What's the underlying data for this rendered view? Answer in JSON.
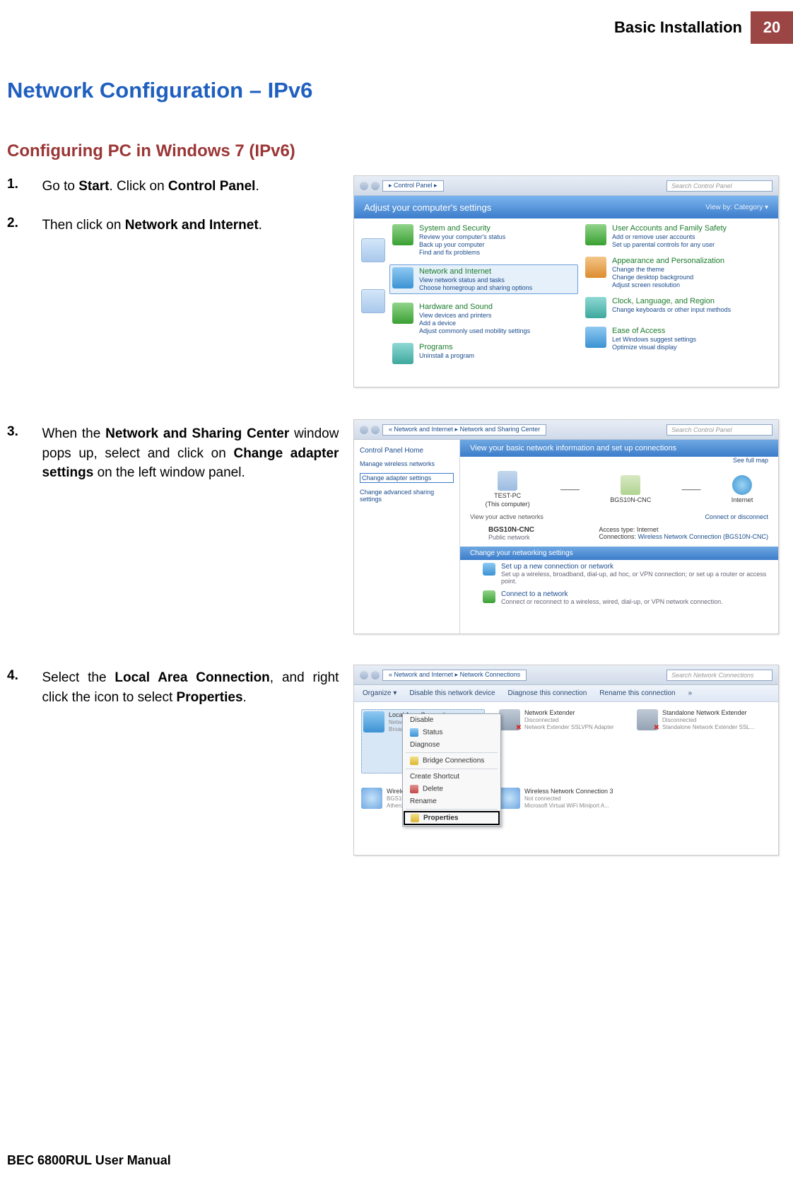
{
  "header": {
    "section": "Basic Installation",
    "page_number": "20"
  },
  "titles": {
    "main": "Network Configuration – IPv6",
    "sub": "Configuring PC in Windows 7 (IPv6)"
  },
  "steps": {
    "s1": {
      "num": "1.",
      "t1": "Go to ",
      "b1": "Start",
      "t2": ". Click on ",
      "b2": "Control Panel",
      "t3": "."
    },
    "s2": {
      "num": "2.",
      "t1": "Then click on ",
      "b1": "Network and Internet",
      "t2": "."
    },
    "s3": {
      "num": "3.",
      "t1": "When the ",
      "b1": "Network and Sharing Center",
      "t2": " window pops up, select and click on ",
      "b2": "Change adapter settings",
      "t3": " on the left window panel."
    },
    "s4": {
      "num": "4.",
      "t1": "Select the ",
      "b1": "Local Area Connection",
      "t2": ", and right click the icon to select ",
      "b2": "Properties",
      "t3": "."
    }
  },
  "shot1": {
    "crumb": "▸ Control Panel ▸",
    "search": "Search Control Panel",
    "banner": "Adjust your computer's settings",
    "viewby": "View by:   Category ▾",
    "left": [
      {
        "title": "System and Security",
        "links": [
          "Review your computer's status",
          "Back up your computer",
          "Find and fix problems"
        ],
        "ic": "ci-green"
      },
      {
        "title": "Network and Internet",
        "links": [
          "View network status and tasks",
          "Choose homegroup and sharing options"
        ],
        "ic": "ci-blue",
        "hl": true
      },
      {
        "title": "Hardware and Sound",
        "links": [
          "View devices and printers",
          "Add a device",
          "Adjust commonly used mobility settings"
        ],
        "ic": "ci-green"
      },
      {
        "title": "Programs",
        "links": [
          "Uninstall a program"
        ],
        "ic": "ci-teal"
      }
    ],
    "right": [
      {
        "title": "User Accounts and Family Safety",
        "links": [
          "Add or remove user accounts",
          "Set up parental controls for any user"
        ],
        "ic": "ci-green"
      },
      {
        "title": "Appearance and Personalization",
        "links": [
          "Change the theme",
          "Change desktop background",
          "Adjust screen resolution"
        ],
        "ic": "ci-orange"
      },
      {
        "title": "Clock, Language, and Region",
        "links": [
          "Change keyboards or other input methods"
        ],
        "ic": "ci-teal"
      },
      {
        "title": "Ease of Access",
        "links": [
          "Let Windows suggest settings",
          "Optimize visual display"
        ],
        "ic": "ci-blue"
      }
    ]
  },
  "shot2": {
    "crumb": "« Network and Internet ▸ Network and Sharing Center",
    "search": "Search Control Panel",
    "sidebar": {
      "title": "Control Panel Home",
      "links": {
        "wireless": "Manage wireless networks",
        "adapter": "Change adapter settings",
        "advanced": "Change advanced sharing settings"
      }
    },
    "bluebar": "View your basic network information and set up connections",
    "seefull": "See full map",
    "net": {
      "pc": "TEST-PC",
      "pc_sub": "(This computer)",
      "router": "BGS10N-CNC",
      "inet": "Internet"
    },
    "active_label": "View your active networks",
    "disconnect": "Connect or disconnect",
    "conn": {
      "name": "BGS10N-CNC",
      "type": "Public network",
      "at_label": "Access type:",
      "at_val": "Internet",
      "cn_label": "Connections:",
      "cn_val": "Wireless Network Connection (BGS10N-CNC)"
    },
    "change_bar": "Change your networking settings",
    "settings": [
      {
        "title": "Set up a new connection or network",
        "desc": "Set up a wireless, broadband, dial-up, ad hoc, or VPN connection; or set up a router or access point.",
        "ic": "si-blue"
      },
      {
        "title": "Connect to a network",
        "desc": "Connect or reconnect to a wireless, wired, dial-up, or VPN network connection.",
        "ic": "si-green"
      }
    ]
  },
  "shot3": {
    "crumb": "« Network and Internet ▸ Network Connections",
    "search": "Search Network Connections",
    "toolbar": [
      "Organize ▾",
      "Disable this network device",
      "Diagnose this connection",
      "Rename this connection",
      "»"
    ],
    "items": [
      {
        "t1": "Local Area Connection",
        "t2": "Network",
        "t3": "Broadcom",
        "ic": "cable",
        "sel": true
      },
      {
        "t1": "Network Extender",
        "t2": "Disconnected",
        "t3": "Network Extender SSLVPN Adapter",
        "ic": "cablex"
      },
      {
        "t1": "Standalone Network Extender",
        "t2": "Disconnected",
        "t3": "Standalone Network Extender SSL...",
        "ic": "cablex"
      },
      {
        "t1": "Wireless Network Connection",
        "t2": "BGS10N-CNC",
        "t3": "Atheros",
        "ic": "wifi"
      },
      {
        "t1": "Wireless Network Connection 3",
        "t2": "Not connected",
        "t3": "Microsoft Virtual WiFi Miniport A...",
        "ic": "wifi"
      }
    ],
    "menu": {
      "disable": "Disable",
      "status": "Status",
      "diagnose": "Diagnose",
      "bridge": "Bridge Connections",
      "shortcut": "Create Shortcut",
      "delete": "Delete",
      "rename": "Rename",
      "properties": "Properties"
    }
  },
  "footer": "BEC 6800RUL User Manual"
}
